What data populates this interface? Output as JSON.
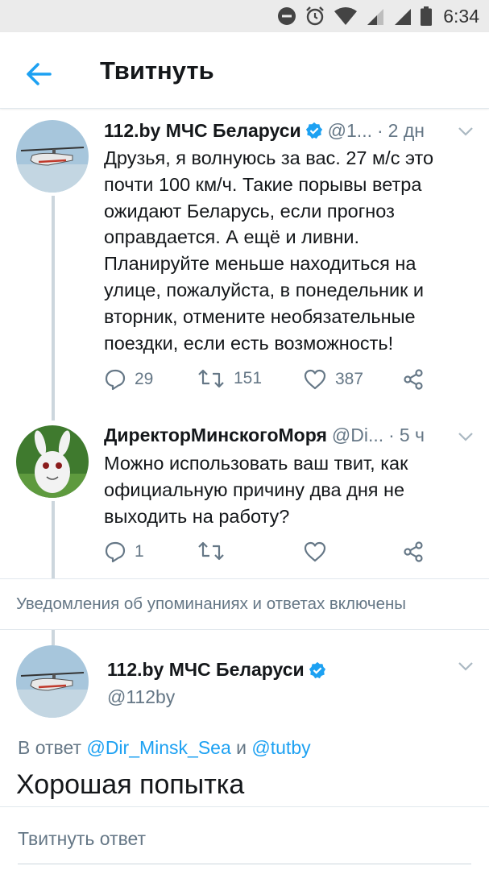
{
  "status_bar": {
    "time": "6:34",
    "icons": [
      "dnd-icon",
      "alarm-icon",
      "wifi-icon",
      "signal-icon",
      "signal-icon",
      "battery-icon"
    ]
  },
  "header": {
    "title": "Твитнуть",
    "back_icon": "arrow-left-icon"
  },
  "thread": [
    {
      "name": "112.by МЧС Беларуси",
      "verified": true,
      "handle": "@1...",
      "separator": "·",
      "time": "2 дн",
      "text": "Друзья, я волнуюсь за вас. 27 м/с это почти 100 км/ч. Такие порывы ветра ожидают Беларусь, если прогноз оправдается. А ещё и ливни. Планируйте меньше находиться на улице, пожалуйста, в понедельник и вторник, отмените необязательные поездки, если есть возможность!",
      "replies": "29",
      "retweets": "151",
      "likes": "387"
    },
    {
      "name": "ДиректорМинскогоМоря",
      "verified": false,
      "handle": "@Di...",
      "separator": "·",
      "time": "5 ч",
      "text": "Можно использовать ваш твит, как официальную причину два дня не выходить на работу?",
      "replies": "1",
      "retweets": "",
      "likes": ""
    }
  ],
  "notice": "Уведомления об упоминаниях и ответах включены",
  "main_tweet": {
    "name": "112.by МЧС Беларуси",
    "verified": true,
    "handle": "@112by",
    "reply_prefix": "В ответ",
    "mention_1": "@Dir_Minsk_Sea",
    "conjunction": "и",
    "mention_2": "@tutby",
    "text": "Хорошая попытка"
  },
  "reply_box": {
    "placeholder": "Твитнуть ответ"
  },
  "colors": {
    "accent": "#1da1f2",
    "muted": "#657786",
    "text": "#14171a",
    "border": "#e1e8ed"
  }
}
